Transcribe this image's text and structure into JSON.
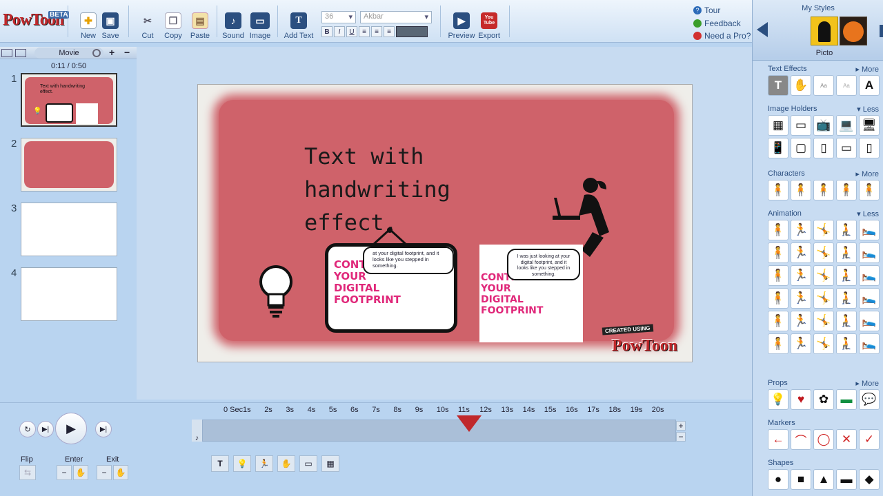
{
  "app": {
    "name": "PowToon",
    "badge": "BETA"
  },
  "toolbar": {
    "new": "New",
    "save": "Save",
    "cut": "Cut",
    "copy": "Copy",
    "paste": "Paste",
    "sound": "Sound",
    "image": "Image",
    "add_text": "Add Text",
    "font_size": "36",
    "font_name": "Akbar",
    "preview": "Preview",
    "export": "Export",
    "export_icon_text": "You Tube"
  },
  "help": {
    "tour": "Tour",
    "feedback": "Feedback",
    "pro": "Need a Pro?"
  },
  "slides_panel": {
    "mode": "Movie",
    "time": "0:11 / 0:50",
    "numbers": [
      "1",
      "2",
      "3",
      "4"
    ]
  },
  "slide1_thumb_text": "Text with handwriting effect.",
  "canvas": {
    "headline": "Text with handwriting effect.",
    "bubble_text": "at your digital footprint, and it looks like you stepped in something.",
    "card_bubble_text": "I was just looking at your digital footprint, and it looks like you stepped in something.",
    "footprint_text": "CONTROL YOUR DIGITAL FOOTPRINT",
    "watermark_small": "CREATED USING",
    "watermark_big": "PowToon"
  },
  "timeline": {
    "ticks": [
      "0 Sec",
      "1s",
      "2s",
      "3s",
      "4s",
      "5s",
      "6s",
      "7s",
      "8s",
      "9s",
      "10s",
      "11s",
      "12s",
      "13s",
      "14s",
      "15s",
      "16s",
      "17s",
      "18s",
      "19s",
      "20s"
    ],
    "current": "11s",
    "playhead_position_s": 11.5,
    "flip": "Flip",
    "enter": "Enter",
    "exit": "Exit"
  },
  "right_panel": {
    "my_styles": "My Styles",
    "style_name": "Picto",
    "text_effects": "Text Effects",
    "text_effects_toggle": "More",
    "image_holders": "Image Holders",
    "image_holders_toggle": "Less",
    "characters": "Characters",
    "characters_toggle": "More",
    "animation": "Animation",
    "animation_toggle": "Less",
    "props": "Props",
    "props_toggle": "More",
    "markers": "Markers",
    "shapes": "Shapes"
  },
  "colors": {
    "accent": "#2b4f80",
    "stage_red": "#cf626a",
    "brand_red": "#c0282b"
  }
}
